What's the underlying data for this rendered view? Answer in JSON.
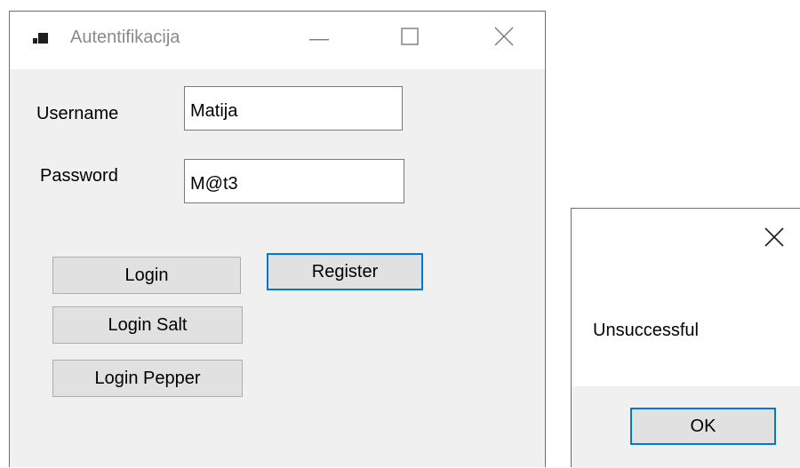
{
  "window": {
    "title": "Autentifikacija",
    "icon": "app-window-icon",
    "controls": {
      "minimize": "minimize-icon",
      "maximize": "maximize-icon",
      "close": "close-icon"
    }
  },
  "form": {
    "username_label": "Username",
    "username_value": "Matija",
    "password_label": "Password",
    "password_value": "M@t3"
  },
  "buttons": {
    "login": "Login",
    "register": "Register",
    "login_salt": "Login Salt",
    "login_pepper": "Login Pepper"
  },
  "message_box": {
    "text": "Unsuccessful",
    "ok": "OK",
    "close": "close-icon"
  },
  "colors": {
    "focus_border": "#0078d7",
    "button_face": "#e1e1e1",
    "window_bg": "#f0f0f0"
  }
}
